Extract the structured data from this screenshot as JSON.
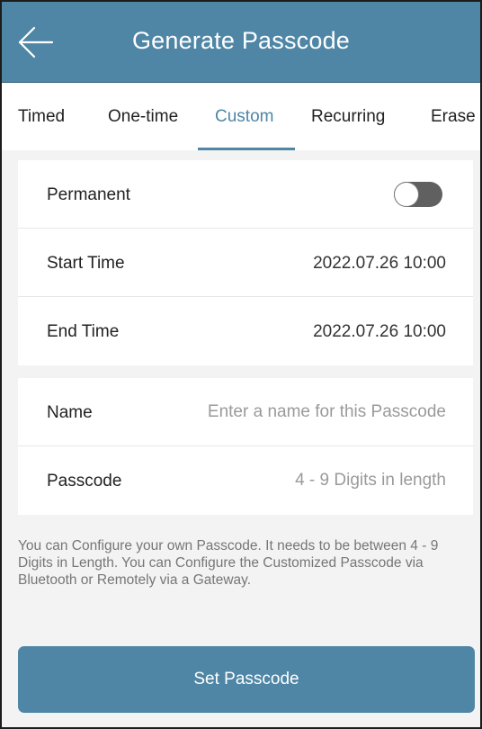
{
  "header": {
    "title": "Generate Passcode",
    "back_icon": "arrow-left-icon"
  },
  "tabs": [
    {
      "label": "Timed",
      "active": false
    },
    {
      "label": "One-time",
      "active": false
    },
    {
      "label": "Custom",
      "active": true
    },
    {
      "label": "Recurring",
      "active": false
    },
    {
      "label": "Erase",
      "active": false
    }
  ],
  "schedule": {
    "permanent_label": "Permanent",
    "permanent_on": false,
    "start_label": "Start Time",
    "start_value": "2022.07.26 10:00",
    "end_label": "End Time",
    "end_value": "2022.07.26 10:00"
  },
  "details": {
    "name_label": "Name",
    "name_value": "",
    "name_placeholder": "Enter a name for this Passcode",
    "passcode_label": "Passcode",
    "passcode_value": "",
    "passcode_placeholder": "4 - 9 Digits in length"
  },
  "note": "You can Configure your own Passcode. It needs to be between 4 - 9 Digits in Length. You can Configure the Customized Passcode via Bluetooth or Remotely via a Gateway.",
  "action": {
    "label": "Set Passcode"
  },
  "colors": {
    "accent": "#4f86a6",
    "background": "#f3f3f3",
    "toggle_off": "#606060"
  }
}
